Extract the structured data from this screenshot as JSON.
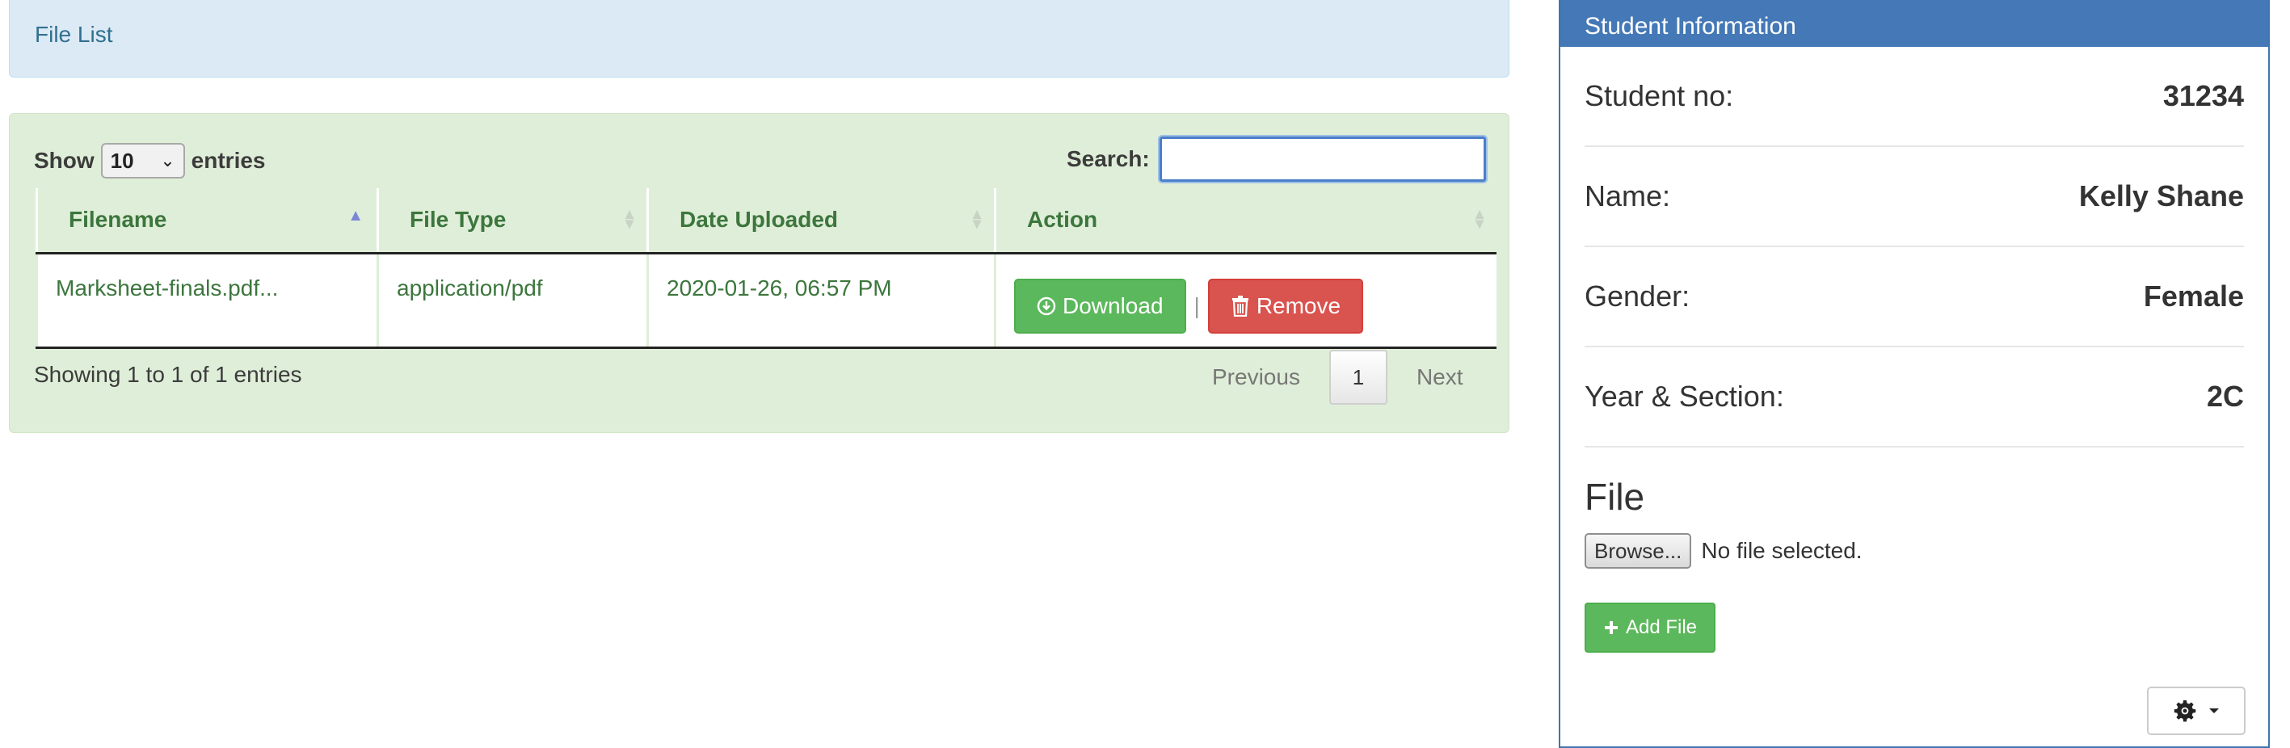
{
  "file_list_panel": {
    "title": "File List"
  },
  "table": {
    "length": {
      "show_label": "Show",
      "value": "10",
      "entries_label": "entries"
    },
    "search": {
      "label": "Search:",
      "value": ""
    },
    "columns": [
      "Filename",
      "File Type",
      "Date Uploaded",
      "Action"
    ],
    "rows": [
      {
        "filename": "Marksheet-finals.pdf...",
        "file_type": "application/pdf",
        "date_uploaded": "2020-01-26, 06:57 PM",
        "download_label": "Download",
        "separator": "|",
        "remove_label": "Remove"
      }
    ],
    "info": "Showing 1 to 1 of 1 entries",
    "pagination": {
      "previous": "Previous",
      "current": "1",
      "next": "Next"
    }
  },
  "student_panel": {
    "title": "Student Information",
    "fields": [
      {
        "label": "Student no:",
        "value": "31234"
      },
      {
        "label": "Name:",
        "value": "Kelly Shane"
      },
      {
        "label": "Gender:",
        "value": "Female"
      },
      {
        "label": "Year & Section:",
        "value": "2C"
      }
    ],
    "file_heading": "File",
    "browse_label": "Browse...",
    "no_file_text": "No file selected.",
    "add_file_label": "Add File"
  },
  "colors": {
    "success": "#5cb85c",
    "danger": "#d9534f",
    "primary": "#4478b6",
    "info_bg": "#dceaf5",
    "success_bg": "#dfeed8"
  },
  "icons": [
    "sort-asc-icon",
    "sort-icon",
    "download-icon",
    "trash-icon",
    "plus-icon",
    "gear-icon",
    "caret-down-icon",
    "chevron-down-icon"
  ]
}
